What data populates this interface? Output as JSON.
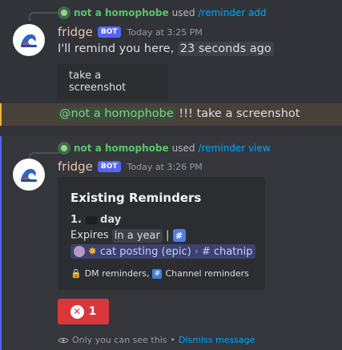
{
  "messages": [
    {
      "reply": {
        "user": "not a homophobe",
        "used": "used",
        "command": "/reminder add"
      },
      "author": "fridge",
      "bot_tag": "BOT",
      "timestamp": "Today at 3:25 PM",
      "text_prefix": "I'll remind you here,",
      "relative_time": "23 seconds ago",
      "quote": "take a screenshot"
    },
    {
      "mention": "@not a homophobe",
      "text": "!!! take a screenshot"
    },
    {
      "reply": {
        "user": "not a homophobe",
        "used": "used",
        "command": "/reminder view"
      },
      "author": "fridge",
      "bot_tag": "BOT",
      "timestamp": "Today at 3:26 PM",
      "embed": {
        "title": "Existing Reminders",
        "item_number": "1.",
        "item_title": "day",
        "expires_label": "Expires",
        "expires_value": "in a year",
        "separator": "|",
        "hash_symbol": "#",
        "channel_category": "cat posting (epic)",
        "channel_name": "chatnip",
        "footer": [
          {
            "icon": "lock-icon",
            "label": "DM reminders,"
          },
          {
            "icon": "channel-icon",
            "label": "Channel reminders"
          }
        ]
      },
      "button_count": "1",
      "ephemeral": {
        "text": "Only you can see this",
        "dot": "•",
        "dismiss": "Dismiss message"
      }
    }
  ],
  "colors": {
    "background": "#313338",
    "mention_highlight": "#48413a",
    "mention_bar": "#f0b232",
    "ephemeral_bar": "#5865f2",
    "danger": "#da373c",
    "link": "#00a8fc"
  }
}
